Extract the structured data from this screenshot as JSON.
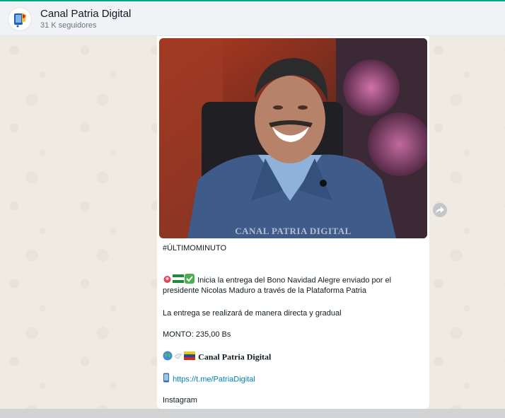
{
  "header": {
    "channel_name": "Canal Patria Digital",
    "followers": "31 K seguidores"
  },
  "post": {
    "image_watermark": "CANAL PATRIA DIGITAL",
    "hashtag": "#ÚLTIMOMINUTO",
    "line1": "Inicia la entrega del Bono Navidad Alegre enviado por el",
    "line2": "presidente Nicolas Maduro a través de la Plataforma Patria",
    "delivery": "La entrega se realizará de manera directa y gradual",
    "amount": "MONTO: 235,00 Bs",
    "signature": "Canal Patria Digital",
    "link": "https://t.me/PatriaDigital",
    "instagram": "Instagram"
  },
  "icons": {
    "forward": "forward-icon",
    "avatar": "channel-logo",
    "emoji_row1": [
      "siren-emoji",
      "flag-emoji",
      "check-emoji"
    ],
    "emoji_row2": [
      "globe-emoji",
      "dove-emoji",
      "venezuela-flag-emoji"
    ],
    "phone": "mobile-phone-emoji"
  },
  "colors": {
    "accent": "#00a884",
    "link": "#027eb5",
    "chat_bg": "#efeae2"
  }
}
